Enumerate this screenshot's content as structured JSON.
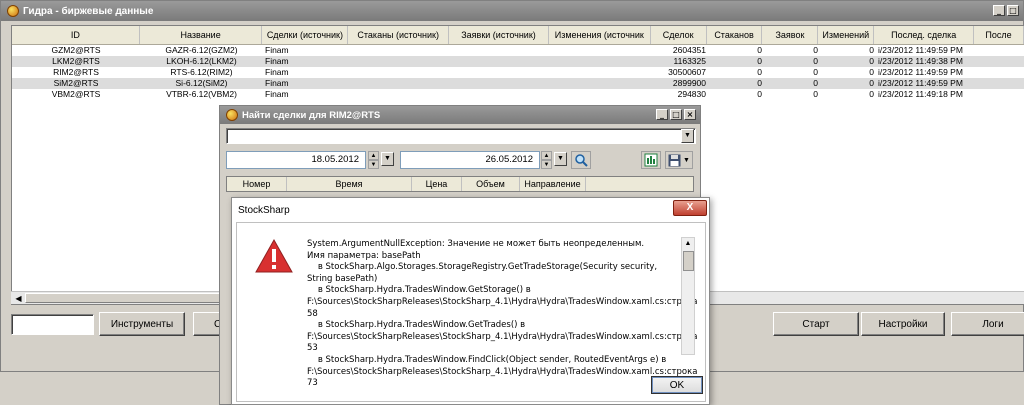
{
  "main": {
    "title": "Гидра - биржевые данные",
    "columns": [
      "ID",
      "Название",
      "Сделки (источник)",
      "Стаканы (источник)",
      "Заявки (источник)",
      "Изменения (источник",
      "Сделок",
      "Стаканов",
      "Заявок",
      "Изменений",
      "Послед. сделка",
      "После"
    ],
    "rows": [
      {
        "id": "GZM2@RTS",
        "name": "GAZR-6.12(GZM2)",
        "src": "Finam",
        "trades": "2604351",
        "depths": "0",
        "orders": "0",
        "changes": "0",
        "last": "i/23/2012 11:49:59 PM"
      },
      {
        "id": "LKM2@RTS",
        "name": "LKOH-6.12(LKM2)",
        "src": "Finam",
        "trades": "1163325",
        "depths": "0",
        "orders": "0",
        "changes": "0",
        "last": "i/23/2012 11:49:38 PM"
      },
      {
        "id": "RIM2@RTS",
        "name": "RTS-6.12(RIM2)",
        "src": "Finam",
        "trades": "30500607",
        "depths": "0",
        "orders": "0",
        "changes": "0",
        "last": "i/23/2012 11:49:59 PM"
      },
      {
        "id": "SiM2@RTS",
        "name": "Si-6.12(SiM2)",
        "src": "Finam",
        "trades": "2899900",
        "depths": "0",
        "orders": "0",
        "changes": "0",
        "last": "i/23/2012 11:49:59 PM"
      },
      {
        "id": "VBM2@RTS",
        "name": "VTBR-6.12(VBM2)",
        "src": "Finam",
        "trades": "294830",
        "depths": "0",
        "orders": "0",
        "changes": "0",
        "last": "i/23/2012 11:49:18 PM"
      }
    ],
    "buttons": {
      "instruments": "Инструменты",
      "partial": "С",
      "start": "Старт",
      "settings": "Настройки",
      "logs": "Логи"
    }
  },
  "find": {
    "title": "Найти сделки для RIM2@RTS",
    "date_from": "18.05.2012",
    "date_to": "26.05.2012",
    "columns": [
      "Номер",
      "Время",
      "Цена",
      "Объем",
      "Направление"
    ]
  },
  "error": {
    "title": "StockSharp",
    "close": "X",
    "message": "System.ArgumentNullException: Значение не может быть неопределенным.\nИмя параметра: basePath\n    в StockSharp.Algo.Storages.StorageRegistry.GetTradeStorage(Security security, String basePath)\n    в StockSharp.Hydra.TradesWindow.GetStorage() в F:\\Sources\\StockSharpReleases\\StockSharp_4.1\\Hydra\\Hydra\\TradesWindow.xaml.cs:строка 58\n    в StockSharp.Hydra.TradesWindow.GetTrades() в F:\\Sources\\StockSharpReleases\\StockSharp_4.1\\Hydra\\Hydra\\TradesWindow.xaml.cs:строка 53\n    в StockSharp.Hydra.TradesWindow.FindClick(Object sender, RoutedEventArgs e) в F:\\Sources\\StockSharpReleases\\StockSharp_4.1\\Hydra\\Hydra\\TradesWindow.xaml.cs:строка 73",
    "ok": "OK"
  }
}
